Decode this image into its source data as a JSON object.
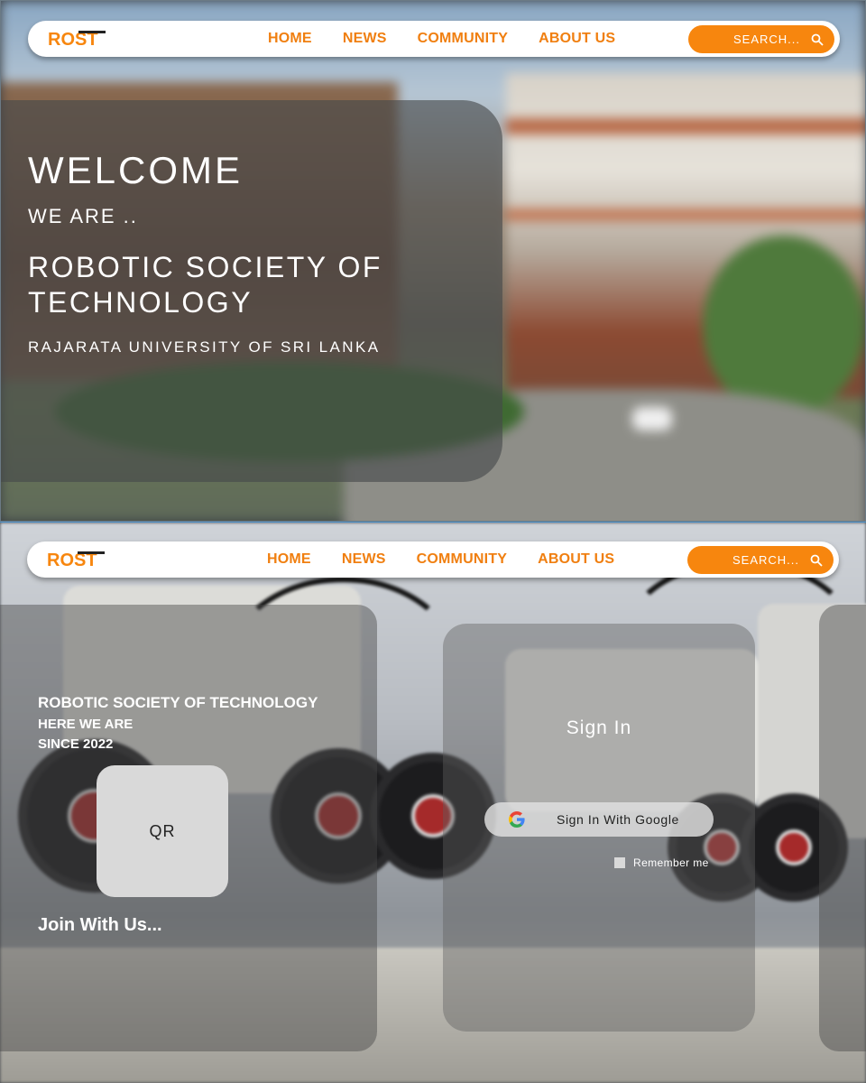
{
  "brand": {
    "logo_text": "ROST",
    "accent": "#f7860e"
  },
  "nav": {
    "links": [
      "HOME",
      "NEWS",
      "COMMUNITY",
      "ABOUT US"
    ],
    "search_placeholder": "SEARCH..."
  },
  "hero": {
    "welcome": "WELCOME",
    "we_are": "WE ARE ..",
    "society": "ROBOTIC SOCIETY OF TECHNOLOGY",
    "university": "RAJARATA UNIVERSITY OF SRI LANKA"
  },
  "join": {
    "title": "ROBOTIC SOCIETY OF TECHNOLOGY",
    "line2": "HERE WE ARE",
    "line3": "SINCE 2022",
    "qr": "QR",
    "cta": "Join With Us..."
  },
  "signin": {
    "title": "Sign In",
    "google_button": "Sign In With Google",
    "remember": "Remember me"
  }
}
